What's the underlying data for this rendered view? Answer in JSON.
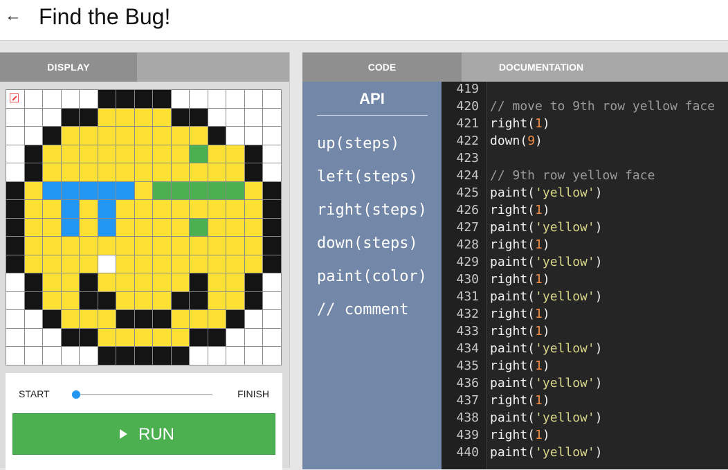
{
  "header": {
    "back_icon": "arrow-left-icon",
    "title": "Find the Bug!"
  },
  "left_panel": {
    "tab_display": "DISPLAY",
    "grid_colors": {
      "Y": "#fce033",
      "K": "#141414",
      "B": "#2196f3",
      "G": "#4caf50",
      "W": "#ffffff"
    },
    "grid": [
      "CWWWWKKKKWWWWWW",
      "WWWKKYYYYKKWWWW",
      "WWKYYYYYYYYKWWW",
      "WKYYYYYYYYGYYKW",
      "WKYYYYYYYYYYYKW",
      "KYBBBBBYGGGGGYK",
      "KYYBYBYYYYYYYYK",
      "KYYBYBYYYYGYYYK",
      "KYYYYYYYYYYYYYK",
      "KYYYYWYYYYYYYYK",
      "WKYYKYYYYYKYYKW",
      "WKYYKKYYYKKYYKW",
      "WWKYYYKKKYYYKWW",
      "WWWKKYYYYYKKWWW",
      "WWWWWKKKKKWWWWW"
    ],
    "slider": {
      "start_label": "START",
      "finish_label": "FINISH",
      "progress": 0
    },
    "run_button": {
      "label": "RUN",
      "icon": "play-icon"
    }
  },
  "right_panel": {
    "tab_code": "CODE",
    "tab_docs": "DOCUMENTATION",
    "api": {
      "title": "API",
      "items": [
        "up(steps)",
        "left(steps)",
        "right(steps)",
        "down(steps)",
        "paint(color)",
        "// comment"
      ]
    },
    "code": [
      {
        "num": "419",
        "parts": []
      },
      {
        "num": "420",
        "parts": [
          {
            "t": "// move to 9th row yellow face",
            "k": "comment"
          }
        ]
      },
      {
        "num": "421",
        "parts": [
          {
            "t": "right(",
            "k": "plain"
          },
          {
            "t": "1",
            "k": "num"
          },
          {
            "t": ")",
            "k": "plain"
          }
        ]
      },
      {
        "num": "422",
        "parts": [
          {
            "t": "down(",
            "k": "plain"
          },
          {
            "t": "9",
            "k": "num"
          },
          {
            "t": ")",
            "k": "plain"
          }
        ]
      },
      {
        "num": "423",
        "parts": []
      },
      {
        "num": "424",
        "parts": [
          {
            "t": "// 9th row yellow face",
            "k": "comment"
          }
        ]
      },
      {
        "num": "425",
        "parts": [
          {
            "t": "paint(",
            "k": "plain"
          },
          {
            "t": "'yellow'",
            "k": "str"
          },
          {
            "t": ")",
            "k": "plain"
          }
        ]
      },
      {
        "num": "426",
        "parts": [
          {
            "t": "right(",
            "k": "plain"
          },
          {
            "t": "1",
            "k": "num"
          },
          {
            "t": ")",
            "k": "plain"
          }
        ]
      },
      {
        "num": "427",
        "parts": [
          {
            "t": "paint(",
            "k": "plain"
          },
          {
            "t": "'yellow'",
            "k": "str"
          },
          {
            "t": ")",
            "k": "plain"
          }
        ]
      },
      {
        "num": "428",
        "parts": [
          {
            "t": "right(",
            "k": "plain"
          },
          {
            "t": "1",
            "k": "num"
          },
          {
            "t": ")",
            "k": "plain"
          }
        ]
      },
      {
        "num": "429",
        "parts": [
          {
            "t": "paint(",
            "k": "plain"
          },
          {
            "t": "'yellow'",
            "k": "str"
          },
          {
            "t": ")",
            "k": "plain"
          }
        ]
      },
      {
        "num": "430",
        "parts": [
          {
            "t": "right(",
            "k": "plain"
          },
          {
            "t": "1",
            "k": "num"
          },
          {
            "t": ")",
            "k": "plain"
          }
        ]
      },
      {
        "num": "431",
        "parts": [
          {
            "t": "paint(",
            "k": "plain"
          },
          {
            "t": "'yellow'",
            "k": "str"
          },
          {
            "t": ")",
            "k": "plain"
          }
        ]
      },
      {
        "num": "432",
        "parts": [
          {
            "t": "right(",
            "k": "plain"
          },
          {
            "t": "1",
            "k": "num"
          },
          {
            "t": ")",
            "k": "plain"
          }
        ]
      },
      {
        "num": "433",
        "parts": [
          {
            "t": "right(",
            "k": "plain"
          },
          {
            "t": "1",
            "k": "num"
          },
          {
            "t": ")",
            "k": "plain"
          }
        ]
      },
      {
        "num": "434",
        "parts": [
          {
            "t": "paint(",
            "k": "plain"
          },
          {
            "t": "'yellow'",
            "k": "str"
          },
          {
            "t": ")",
            "k": "plain"
          }
        ]
      },
      {
        "num": "435",
        "parts": [
          {
            "t": "right(",
            "k": "plain"
          },
          {
            "t": "1",
            "k": "num"
          },
          {
            "t": ")",
            "k": "plain"
          }
        ]
      },
      {
        "num": "436",
        "parts": [
          {
            "t": "paint(",
            "k": "plain"
          },
          {
            "t": "'yellow'",
            "k": "str"
          },
          {
            "t": ")",
            "k": "plain"
          }
        ]
      },
      {
        "num": "437",
        "parts": [
          {
            "t": "right(",
            "k": "plain"
          },
          {
            "t": "1",
            "k": "num"
          },
          {
            "t": ")",
            "k": "plain"
          }
        ]
      },
      {
        "num": "438",
        "parts": [
          {
            "t": "paint(",
            "k": "plain"
          },
          {
            "t": "'yellow'",
            "k": "str"
          },
          {
            "t": ")",
            "k": "plain"
          }
        ]
      },
      {
        "num": "439",
        "parts": [
          {
            "t": "right(",
            "k": "plain"
          },
          {
            "t": "1",
            "k": "num"
          },
          {
            "t": ")",
            "k": "plain"
          }
        ]
      },
      {
        "num": "440",
        "parts": [
          {
            "t": "paint(",
            "k": "plain"
          },
          {
            "t": "'yellow'",
            "k": "str"
          },
          {
            "t": ")",
            "k": "plain"
          }
        ]
      }
    ]
  }
}
